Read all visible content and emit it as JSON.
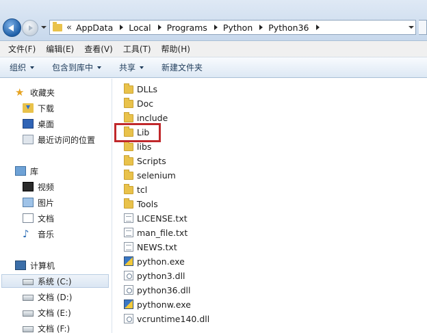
{
  "address": {
    "overflow": "«",
    "crumbs": [
      "AppData",
      "Local",
      "Programs",
      "Python",
      "Python36"
    ]
  },
  "menu": [
    "文件(F)",
    "编辑(E)",
    "查看(V)",
    "工具(T)",
    "帮助(H)"
  ],
  "commands": [
    {
      "label": "组织",
      "dropdown": true
    },
    {
      "label": "包含到库中",
      "dropdown": true
    },
    {
      "label": "共享",
      "dropdown": true
    },
    {
      "label": "新建文件夹",
      "dropdown": false
    }
  ],
  "nav": {
    "favorites": {
      "label": "收藏夹",
      "items": [
        "下载",
        "桌面",
        "最近访问的位置"
      ]
    },
    "libraries": {
      "label": "库",
      "items": [
        "视频",
        "图片",
        "文档",
        "音乐"
      ]
    },
    "computer": {
      "label": "计算机",
      "drives": [
        "系统 (C:)",
        "文档 (D:)",
        "文档 (E:)",
        "文档 (F:)"
      ]
    }
  },
  "files": [
    {
      "name": "DLLs",
      "type": "folder"
    },
    {
      "name": "Doc",
      "type": "folder"
    },
    {
      "name": "include",
      "type": "folder"
    },
    {
      "name": "Lib",
      "type": "folder"
    },
    {
      "name": "libs",
      "type": "folder"
    },
    {
      "name": "Scripts",
      "type": "folder"
    },
    {
      "name": "selenium",
      "type": "folder"
    },
    {
      "name": "tcl",
      "type": "folder"
    },
    {
      "name": "Tools",
      "type": "folder"
    },
    {
      "name": "LICENSE.txt",
      "type": "txt"
    },
    {
      "name": "man_file.txt",
      "type": "txt"
    },
    {
      "name": "NEWS.txt",
      "type": "txt"
    },
    {
      "name": "python.exe",
      "type": "exe"
    },
    {
      "name": "python3.dll",
      "type": "dll"
    },
    {
      "name": "python36.dll",
      "type": "dll"
    },
    {
      "name": "pythonw.exe",
      "type": "exe"
    },
    {
      "name": "vcruntime140.dll",
      "type": "dll"
    }
  ],
  "highlighted_file": "Lib",
  "colors": {
    "highlight": "#c0282b",
    "folder": "#e9c24b"
  }
}
